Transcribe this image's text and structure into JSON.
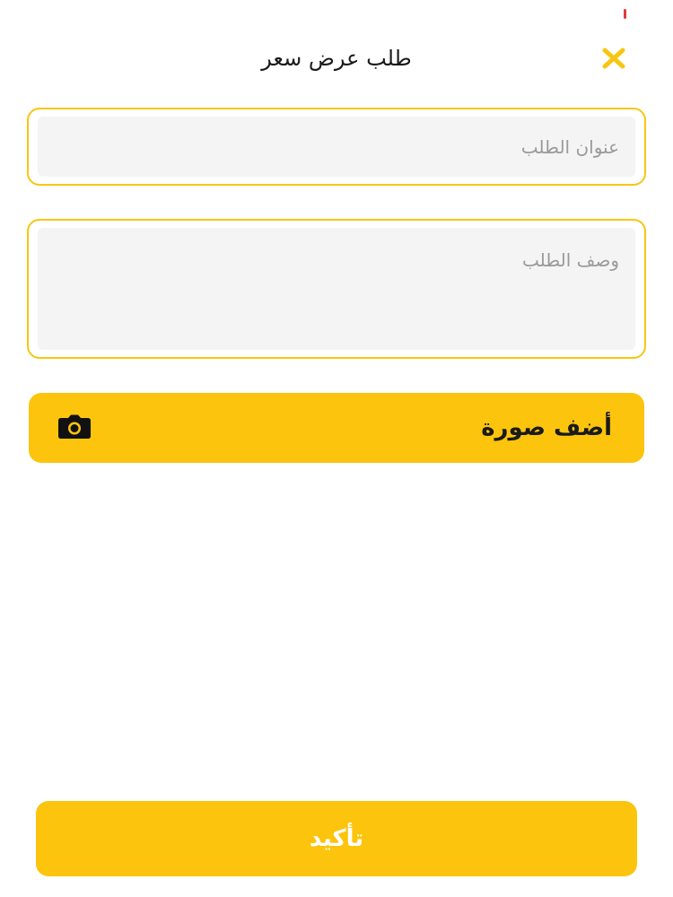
{
  "header": {
    "title": "طلب عرض سعر",
    "close_icon": "close-icon"
  },
  "form": {
    "title_placeholder": "عنوان الطلب",
    "title_value": "",
    "description_placeholder": "وصف الطلب",
    "description_value": "",
    "add_photo_label": "أضف صورة",
    "add_photo_icon": "camera-icon"
  },
  "footer": {
    "confirm_label": "تأكيد"
  },
  "colors": {
    "accent": "#fcc40c",
    "field_border": "#f7c614",
    "field_fill": "#f4f4f4",
    "status_mark": "#e53935"
  }
}
